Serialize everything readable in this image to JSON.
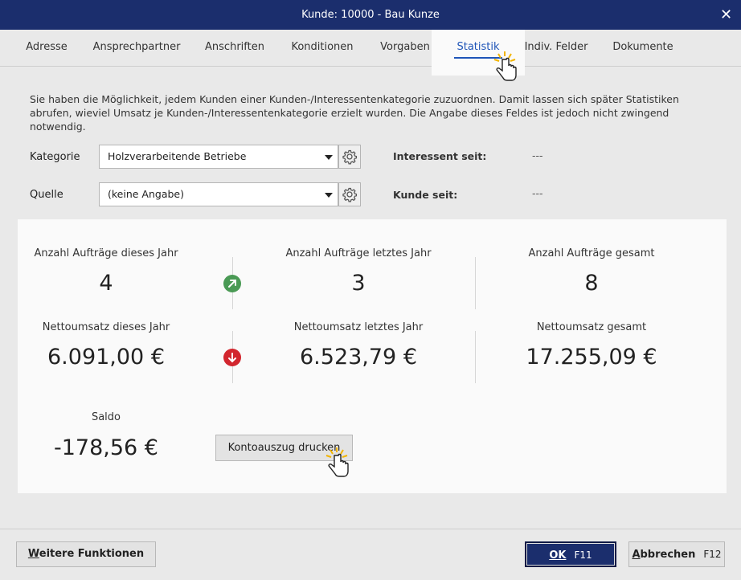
{
  "window": {
    "title": "Kunde: 10000 - Bau Kunze",
    "close_glyph": "✕"
  },
  "tabs": [
    {
      "label": "Adresse"
    },
    {
      "label": "Ansprechpartner"
    },
    {
      "label": "Anschriften"
    },
    {
      "label": "Konditionen"
    },
    {
      "label": "Vorgaben"
    },
    {
      "label": "Statistik",
      "active": true
    },
    {
      "label": "Indiv. Felder"
    },
    {
      "label": "Dokumente"
    }
  ],
  "description": "Sie haben die Möglichkeit, jedem Kunden einer Kunden-/Interessentenkategorie zuzuordnen. Damit lassen sich später Statistiken abrufen, wieviel Umsatz je Kunden-/Interessentenkategorie erzielt wurden. Die Angabe dieses Feldes ist jedoch nicht zwingend notwendig.",
  "form": {
    "kategorie_label": "Kategorie",
    "kategorie_value": "Holzverarbeitende Betriebe",
    "quelle_label": "Quelle",
    "quelle_value": "(keine Angabe)",
    "interessent_label": "Interessent seit:",
    "interessent_value": "---",
    "kunde_label": "Kunde seit:",
    "kunde_value": "---"
  },
  "stats": {
    "auftraege_dieses_label": "Anzahl Aufträge dieses Jahr",
    "auftraege_dieses_value": "4",
    "auftraege_letztes_label": "Anzahl Aufträge letztes Jahr",
    "auftraege_letztes_value": "3",
    "auftraege_gesamt_label": "Anzahl Aufträge gesamt",
    "auftraege_gesamt_value": "8",
    "umsatz_dieses_label": "Nettoumsatz dieses Jahr",
    "umsatz_dieses_value": "6.091,00 €",
    "umsatz_letztes_label": "Nettoumsatz letztes Jahr",
    "umsatz_letztes_value": "6.523,79 €",
    "umsatz_gesamt_label": "Nettoumsatz gesamt",
    "umsatz_gesamt_value": "17.255,09 €",
    "saldo_label": "Saldo",
    "saldo_value": "-178,56 €",
    "kontoauszug_button": "Kontoauszug drucken",
    "trend_auftraege": "arrow-up-right-icon",
    "trend_umsatz": "arrow-down-icon",
    "color_up": "#4a9a55",
    "color_down": "#d2262e"
  },
  "footer": {
    "weitere_first": "W",
    "weitere_rest": "eitere Funktionen",
    "ok_label": "OK",
    "ok_key": "F11",
    "abbrechen_first": "A",
    "abbrechen_rest": "bbrechen",
    "abbrechen_key": "F12"
  },
  "colors": {
    "titlebar": "#1b2e6d",
    "accent": "#1f55b8"
  }
}
